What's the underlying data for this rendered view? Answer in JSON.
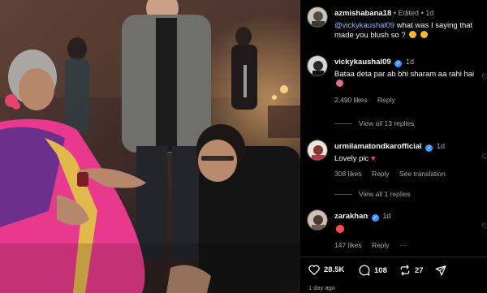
{
  "post": {
    "caption": {
      "username": "azmishabana18",
      "edited": "Edited",
      "time": "1d",
      "mention": "@vickykaushal09",
      "text": " what was I saying that made you blush so ?"
    },
    "comments": [
      {
        "username": "vickykaushal09",
        "time": "1d",
        "text": "Bataa deta par ab bhi sharam aa rahi hai",
        "likes": "2,490 likes",
        "reply": "Reply",
        "view_replies": "View all 13 replies"
      },
      {
        "username": "urmilamatondkarofficial",
        "time": "1d",
        "text": "Lovely pic",
        "likes": "308 likes",
        "reply": "Reply",
        "translation": "See translation",
        "view_replies": "View all 1 replies"
      },
      {
        "username": "zarakhan",
        "time": "1d",
        "likes": "147 likes",
        "reply": "Reply",
        "more": "···"
      }
    ],
    "stats": {
      "likes": "28.5K",
      "comments": "108",
      "reposts": "27"
    },
    "timestamp": "1 day ago"
  },
  "colors": {
    "verified": "#3b96ff",
    "mention": "#8fb8ff",
    "muted": "#a8a8a8"
  }
}
